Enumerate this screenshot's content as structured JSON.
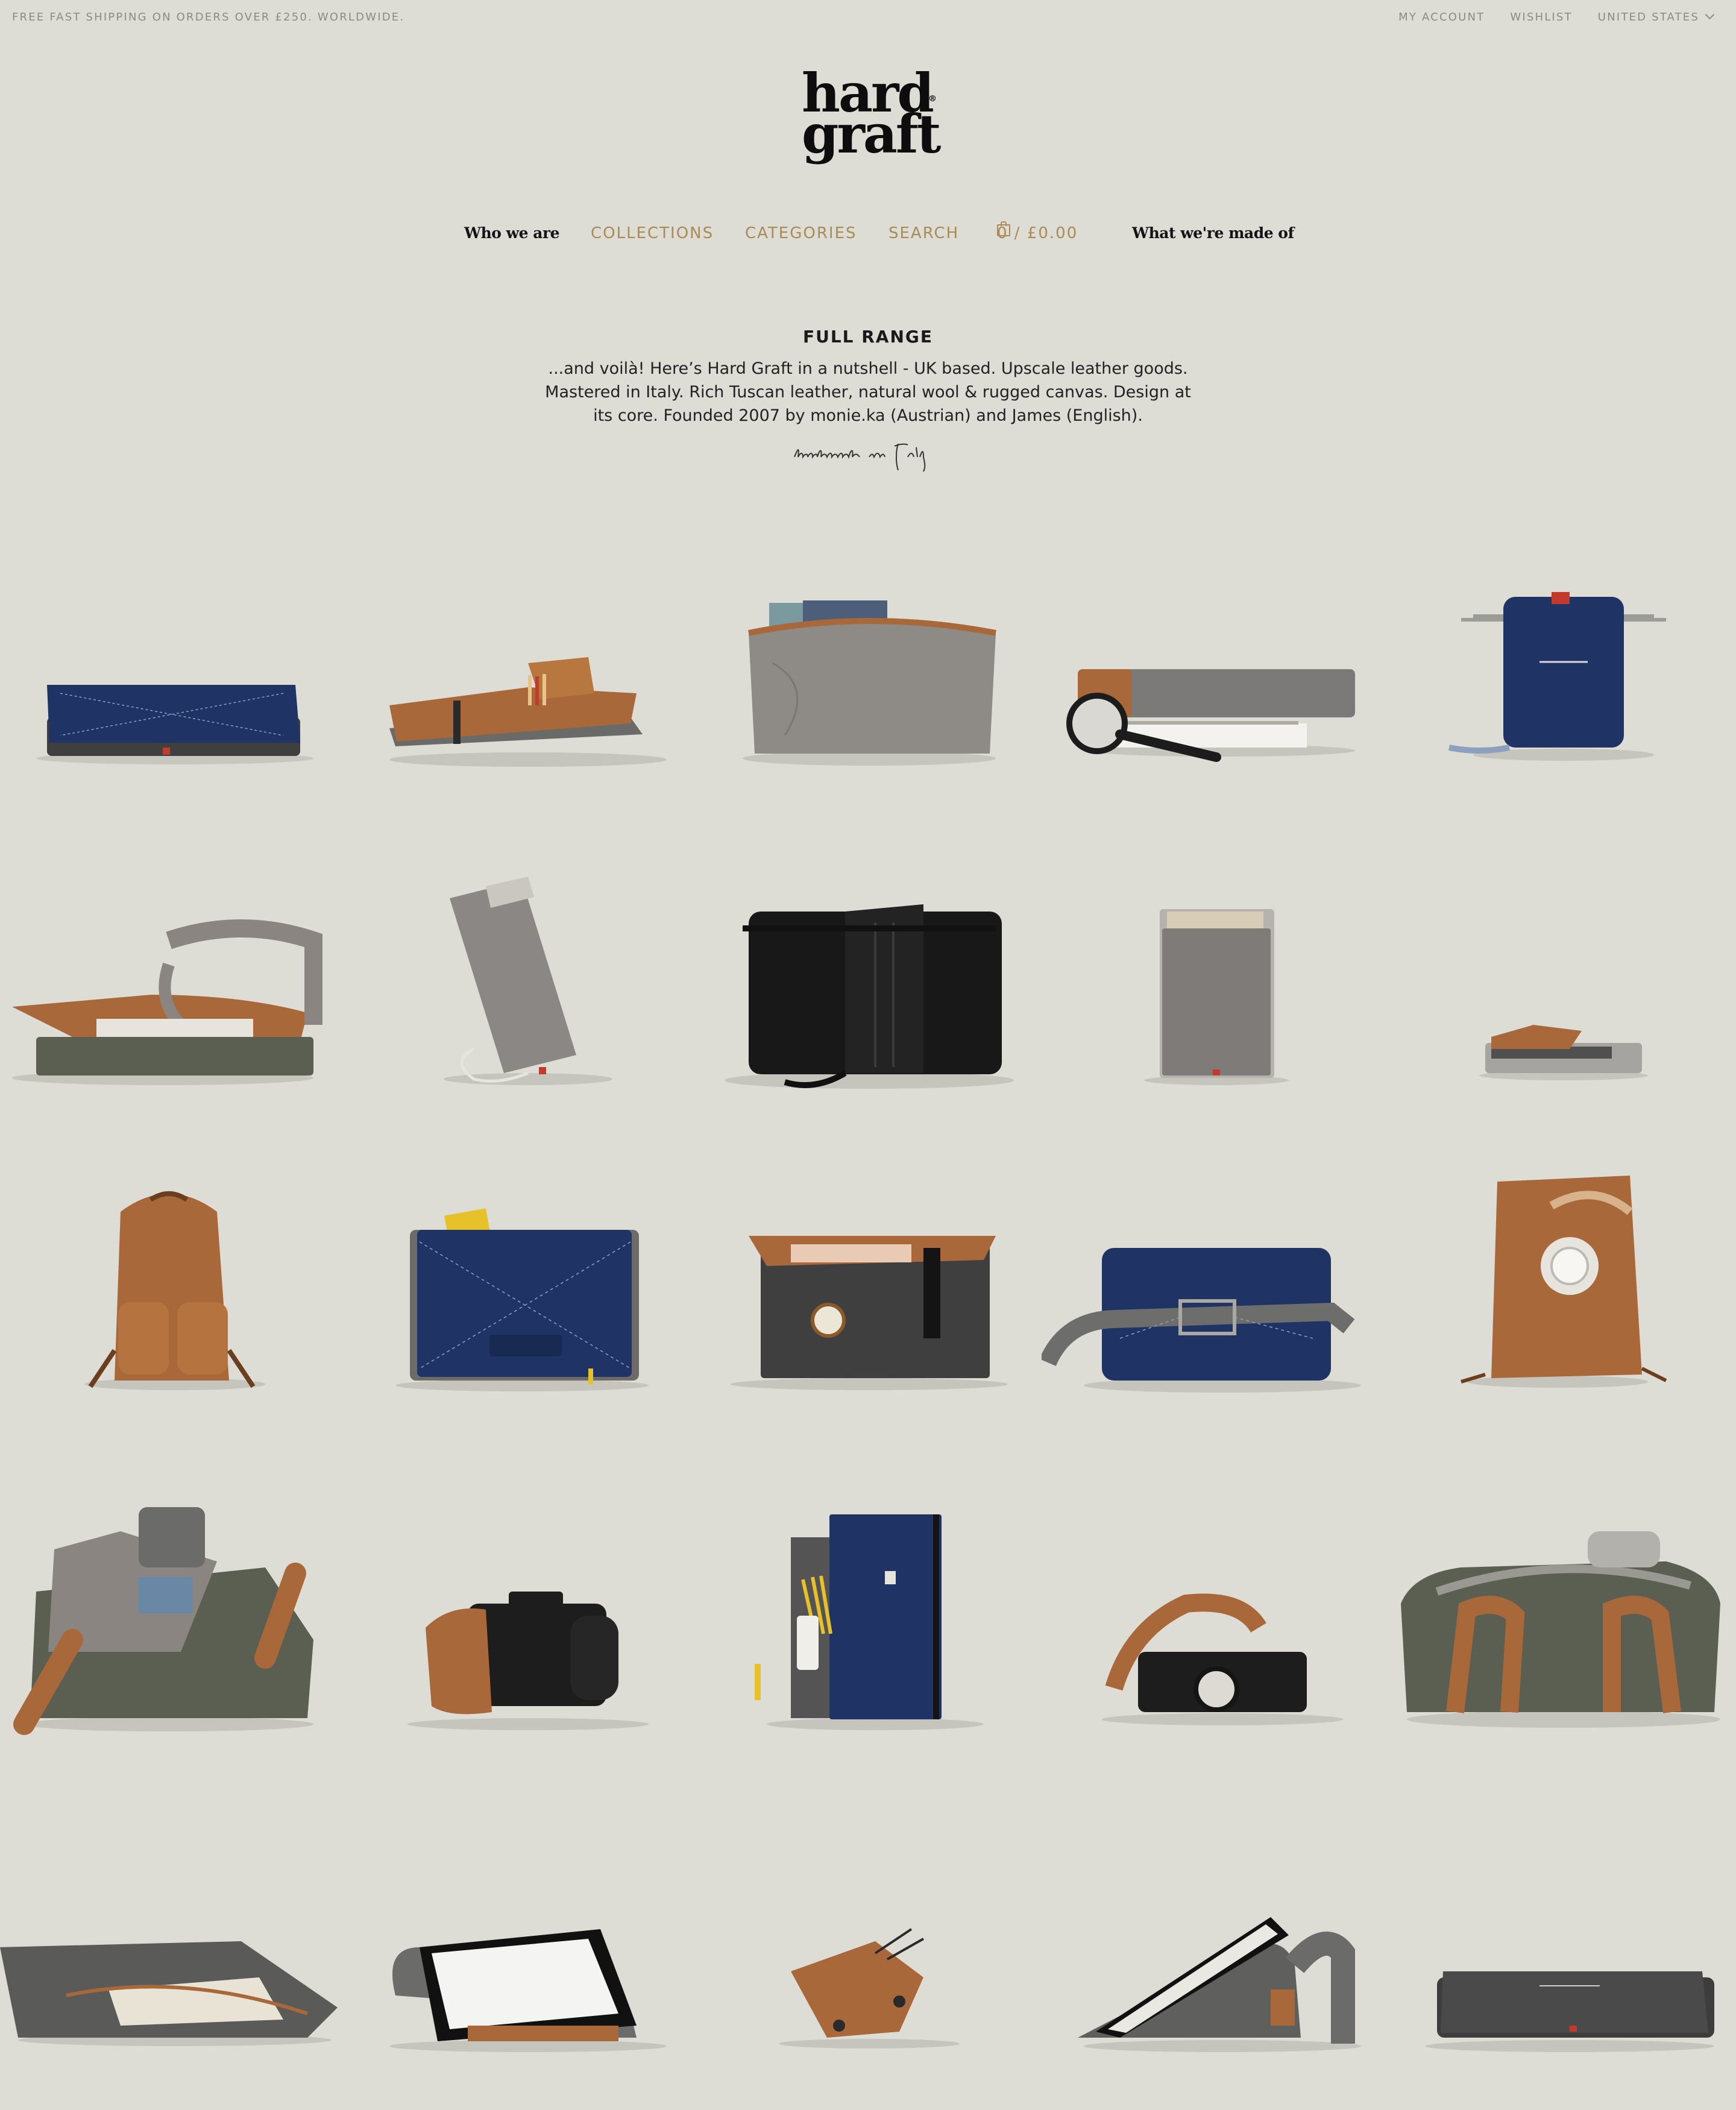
{
  "topbar": {
    "shipping": "FREE FAST SHIPPING ON ORDERS OVER £250. WORLDWIDE.",
    "my_account": "MY ACCOUNT",
    "wishlist": "WISHLIST",
    "country": "UNITED STATES"
  },
  "logo": {
    "line1": "hard",
    "line2": "graft",
    "mark": "®"
  },
  "nav": {
    "who": "Who we are",
    "collections": "COLLECTIONS",
    "categories": "CATEGORIES",
    "search": "SEARCH",
    "cart": "0 / £0.00",
    "made_of": "What we're made of"
  },
  "intro": {
    "title": "FULL RANGE",
    "line1": "...and voilà! Here’s Hard Graft in a nutshell - UK based. Upscale leather goods.",
    "line2": "Mastered in Italy. Rich Tuscan leather, natural wool & rugged canvas. Design at",
    "line3": "its core. Founded 2007 by monie.ka (Austrian) and James (English).",
    "signature": "handmade in Italy"
  },
  "colors": {
    "background": "#dddcd5",
    "accent_gold": "#a88b55",
    "navy": "#1f3465",
    "tan": "#a9683a",
    "felt_gray": "#6b6b6a",
    "canvas_olive": "#5b5f52"
  },
  "products": [
    {
      "icon": "navy-leather-laptop-sleeve"
    },
    {
      "icon": "tan-leather-notebook-folio"
    },
    {
      "icon": "gray-canvas-zip-pouch"
    },
    {
      "icon": "felt-sleeve-with-magnifier"
    },
    {
      "icon": "navy-phone-pouch"
    },
    {
      "icon": "open-canvas-messenger"
    },
    {
      "icon": "gray-phone-sleeve-with-cable"
    },
    {
      "icon": "black-leather-messenger"
    },
    {
      "icon": "felt-card-wallet"
    },
    {
      "icon": "flat-felt-wallet"
    },
    {
      "icon": "tan-leather-backpack"
    },
    {
      "icon": "navy-document-folio"
    },
    {
      "icon": "felt-briefcase-with-watch"
    },
    {
      "icon": "navy-laptop-case-with-strap"
    },
    {
      "icon": "tan-rolltop-bag-with-headphones"
    },
    {
      "icon": "open-canvas-holdall"
    },
    {
      "icon": "camera-with-leather-hand-strap"
    },
    {
      "icon": "navy-pencil-case-with-felt-sleeve"
    },
    {
      "icon": "camera-with-tan-strap"
    },
    {
      "icon": "olive-weekender-bag"
    },
    {
      "icon": "felt-zip-pouch"
    },
    {
      "icon": "tablet-on-felt-stand"
    },
    {
      "icon": "tan-leather-cord-wrap"
    },
    {
      "icon": "tablet-on-felt-stand-side"
    },
    {
      "icon": "gray-leather-laptop-sleeve"
    }
  ]
}
